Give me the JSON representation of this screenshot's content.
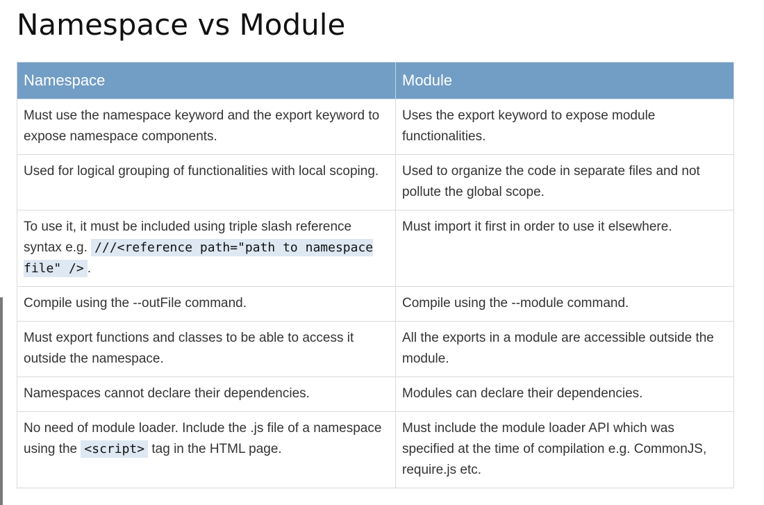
{
  "page": {
    "title": "Namespace vs Module"
  },
  "table": {
    "headers": {
      "namespace": "Namespace",
      "module": "Module"
    },
    "rows": [
      {
        "namespace": "Must use the namespace keyword and the export keyword to expose namespace components.",
        "module": "Uses the export keyword to expose module functionalities."
      },
      {
        "namespace": "Used for logical grouping of functionalities with local scoping.",
        "module": "Used to organize the code in separate files and not pollute the global scope."
      },
      {
        "namespace_before": "To use it, it must be included using triple slash reference syntax e.g. ",
        "namespace_code": "///<reference path=\"path to namespace file\" />",
        "namespace_after": ".",
        "module": "Must import it first in order to use it elsewhere."
      },
      {
        "namespace": "Compile using the --outFile command.",
        "module": "Compile using the --module command."
      },
      {
        "namespace": "Must export functions and classes to be able to access it outside the namespace.",
        "module": "All the exports in a module are accessible outside the module."
      },
      {
        "namespace": "Namespaces cannot declare their dependencies.",
        "module": "Modules can declare their dependencies."
      },
      {
        "namespace_before": "No need of module loader. Include the .js file of a namespace using the ",
        "namespace_code": "<script>",
        "namespace_after": " tag in the HTML page.",
        "module": "Must include the module loader API which was specified at the time of compilation e.g. CommonJS, require.js etc."
      }
    ]
  },
  "colors": {
    "header_background": "#729dc4",
    "header_text": "#ffffff",
    "body_text": "#333333",
    "code_background": "#dde8f2",
    "border": "#d9d9d9"
  }
}
